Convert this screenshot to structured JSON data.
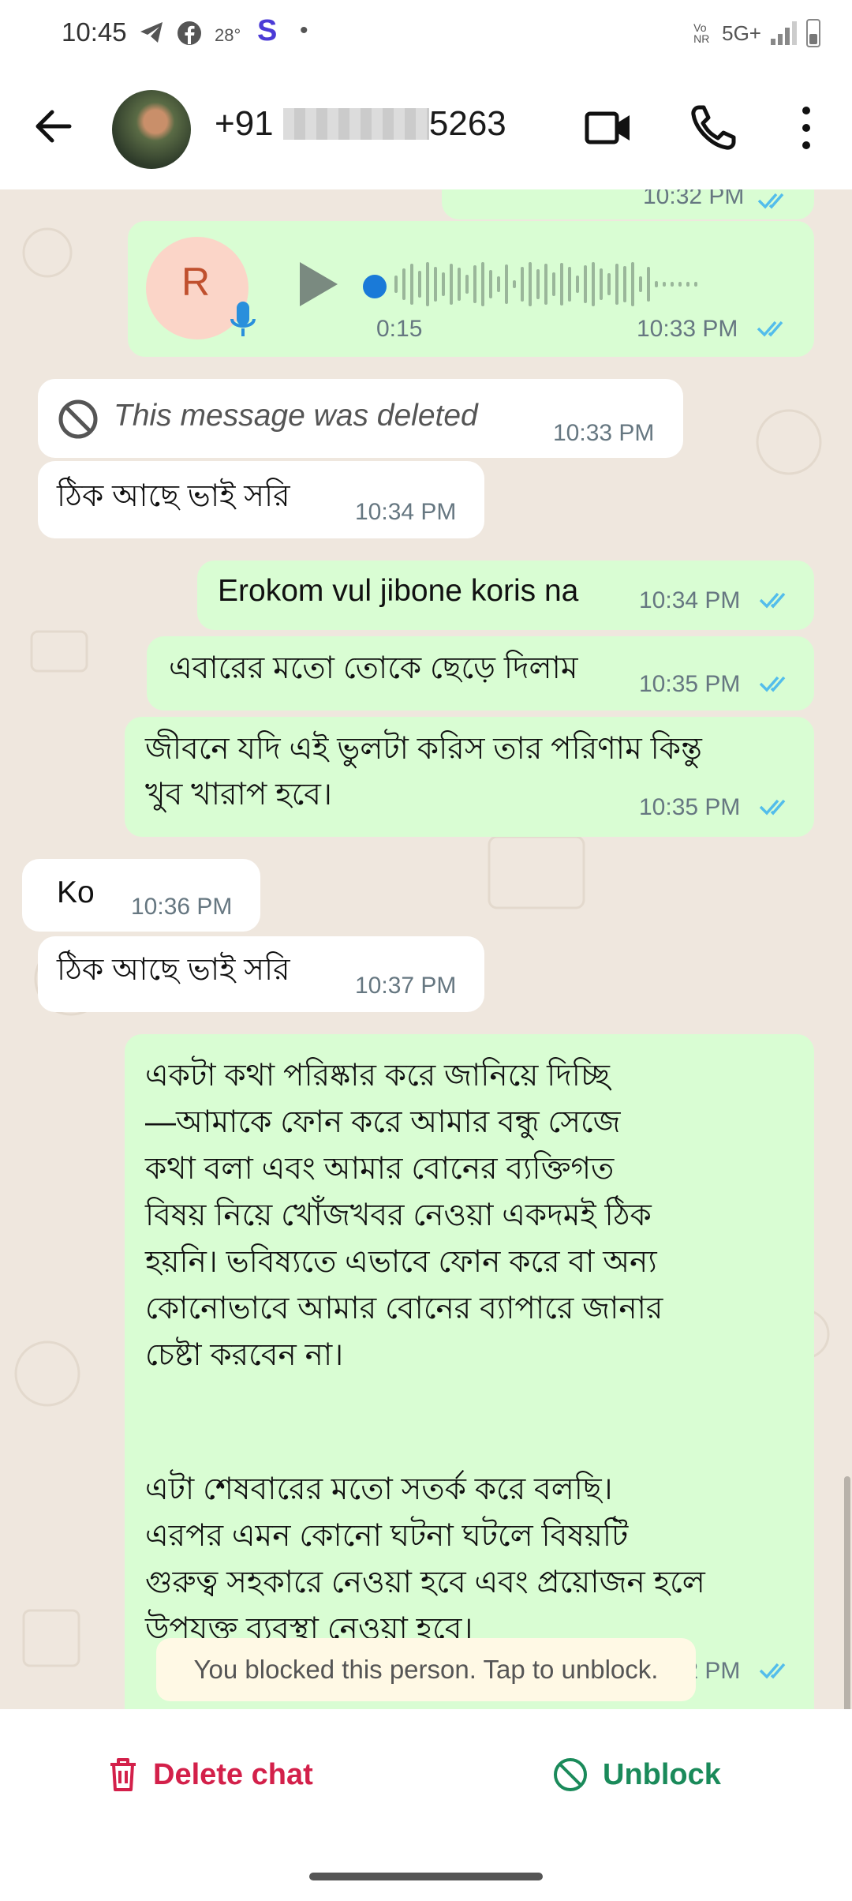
{
  "status_bar": {
    "time": "10:45",
    "temp": "28°",
    "network": "5G+",
    "volte": "Vo NR"
  },
  "header": {
    "contact_prefix": "+91",
    "contact_suffix": "5263"
  },
  "messages": {
    "top_time": "10:32 PM",
    "voice": {
      "avatar_letter": "R",
      "duration": "0:15",
      "time": "10:33 PM"
    },
    "deleted": {
      "text": "This message was deleted",
      "time": "10:33 PM"
    },
    "m1": {
      "text": "ঠিক আছে ভাই সরি",
      "time": "10:34 PM"
    },
    "m2": {
      "text": "Erokom vul jibone koris na",
      "time": "10:34 PM"
    },
    "m3": {
      "text": "এবারের মতো তোকে ছেড়ে দিলাম",
      "time": "10:35 PM"
    },
    "m4": {
      "line1": "জীবনে যদি এই ভুলটা করিস তার পরিণাম কিন্তু",
      "line2": "খুব খারাপ হবে।",
      "time": "10:35 PM"
    },
    "m5": {
      "text": "Ko",
      "time": "10:36 PM"
    },
    "m6": {
      "text": "ঠিক আছে ভাই সরি",
      "time": "10:37 PM"
    },
    "m7": {
      "l1": "একটা কথা পরিষ্কার করে জানিয়ে দিচ্ছি",
      "l2": "—আমাকে ফোন করে আমার বন্ধু সেজে",
      "l3": "কথা বলা এবং আমার বোনের ব্যক্তিগত",
      "l4": "বিষয় নিয়ে খোঁজখবর নেওয়া একদমই ঠিক",
      "l5": "হয়নি। ভবিষ্যতে এভাবে ফোন করে বা অন্য",
      "l6": "কোনোভাবে আমার বোনের ব্যাপারে জানার",
      "l7": "চেষ্টা করবেন না।",
      "l8": "এটা শেষবারের মতো সতর্ক করে বলছি।",
      "l9": "এরপর এমন কোনো ঘটনা ঘটলে বিষয়টি",
      "l10": "গুরুত্ব সহকারে নেওয়া হবে এবং প্রয়োজন হলে",
      "l11": "উপযুক্ত ব্যবস্থা নেওয়া হবে।",
      "time": "10:42 PM"
    },
    "system_notice": "You blocked this person. Tap to unblock."
  },
  "actions": {
    "delete_label": "Delete chat",
    "unblock_label": "Unblock"
  },
  "colors": {
    "outgoing": "#d9fdd3",
    "incoming": "#ffffff",
    "background": "#efe7de",
    "tick_blue": "#53bdeb",
    "delete_red": "#d3204a",
    "unblock_green": "#1a8a5a"
  }
}
